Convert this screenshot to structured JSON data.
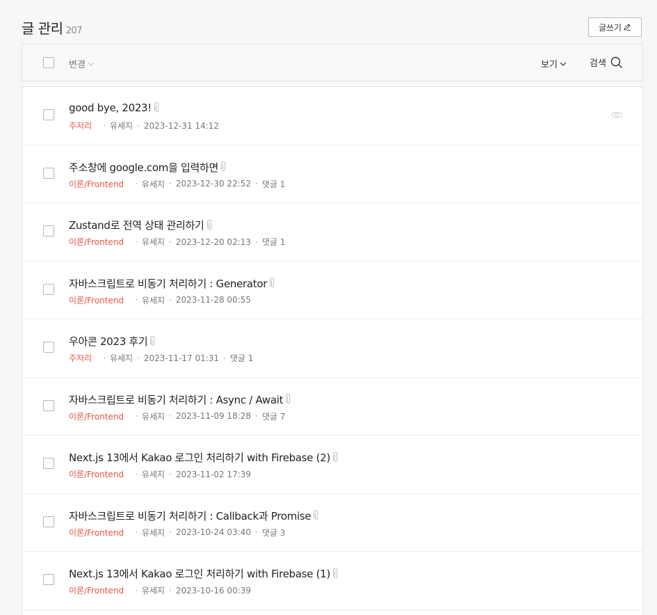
{
  "header": {
    "title": "글 관리",
    "count": "207",
    "write_label": "글쓰기"
  },
  "toolbar": {
    "change_label": "변경",
    "view_label": "보기",
    "search_label": "검색"
  },
  "posts": [
    {
      "title": "good bye, 2023!",
      "category": "주저리",
      "author": "유세지",
      "date": "2023-12-31 14:12",
      "comments": "",
      "has_eye": true
    },
    {
      "title": "주소창에 google.com을 입력하면",
      "category": "이론/Frontend",
      "author": "유세지",
      "date": "2023-12-30 22:52",
      "comments": "댓글 1"
    },
    {
      "title": "Zustand로 전역 상태 관리하기",
      "category": "이론/Frontend",
      "author": "유세지",
      "date": "2023-12-20 02:13",
      "comments": "댓글 1"
    },
    {
      "title": "자바스크립트로 비동기 처리하기 : Generator",
      "category": "이론/Frontend",
      "author": "유세지",
      "date": "2023-11-28 00:55",
      "comments": ""
    },
    {
      "title": "우아콘 2023 후기",
      "category": "주저리",
      "author": "유세지",
      "date": "2023-11-17 01:31",
      "comments": "댓글 1"
    },
    {
      "title": "자바스크립트로 비동기 처리하기 : Async / Await",
      "category": "이론/Frontend",
      "author": "유세지",
      "date": "2023-11-09 18:28",
      "comments": "댓글 7"
    },
    {
      "title": "Next.js 13에서 Kakao 로그인 처리하기 with Firebase (2)",
      "category": "이론/Frontend",
      "author": "유세지",
      "date": "2023-11-02 17:39",
      "comments": ""
    },
    {
      "title": "자바스크립트로 비동기 처리하기 : Callback과 Promise",
      "category": "이론/Frontend",
      "author": "유세지",
      "date": "2023-10-24 03:40",
      "comments": "댓글 3"
    },
    {
      "title": "Next.js 13에서 Kakao 로그인 처리하기 with Firebase (1)",
      "category": "이론/Frontend",
      "author": "유세지",
      "date": "2023-10-16 00:39",
      "comments": ""
    }
  ],
  "colors": {
    "category": "#f0523d",
    "background": "#f6f7f8"
  }
}
